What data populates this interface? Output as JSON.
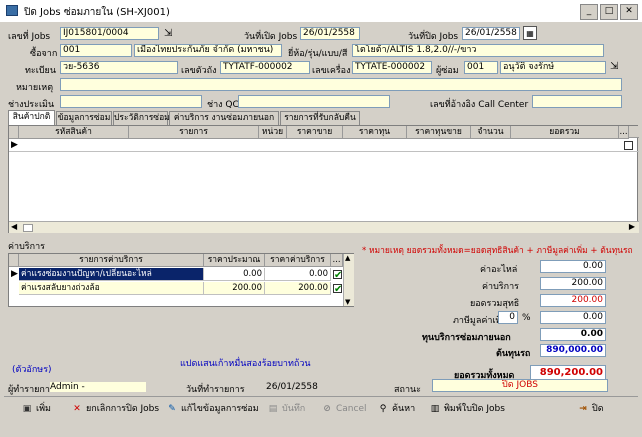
{
  "window": {
    "title": "ปิด Jobs ซ่อมภายใน (SH-XJ001)",
    "min": "_",
    "max": "□",
    "close": "✕"
  },
  "header": {
    "job_no_label": "เลขที่ Jobs",
    "job_no": "IJ015801/0004",
    "open_date_label": "วันที่เปิด Jobs",
    "open_date": "26/01/2558",
    "close_date_label": "วันที่ปิด Jobs",
    "close_date": "26/01/2558",
    "from_label": "ซื้อจาก",
    "from_code": "001",
    "from_name": "เมืองไทยประกันภัย จำกัด (มหาชน)",
    "brand_label": "ยี่ห้อ/รุ่น/แบบ/สี",
    "brand": "โตโยต้า/ALTIS 1.8,2.0//-/ขาว",
    "plate_label": "ทะเบียน",
    "plate": "วย-5636",
    "chassis_label": "เลขตัวถัง",
    "chassis": "TYTATF-000002",
    "engine_label": "เลขเครื่อง",
    "engine": "TYTATE-000002",
    "repairer_label": "ผู้ซ่อม",
    "repairer_code": "001",
    "repairer_name": "อนุวัติ จงรักษ์",
    "note_label": "หมายเหตุ",
    "note": "",
    "assessor_label": "ช่างประเมิน",
    "assessor": "",
    "qc_label": "ช่าง QC",
    "qc": "",
    "callcenter_label": "เลขที่อ้างอิง Call Center",
    "callcenter": ""
  },
  "tabs": [
    "สินค้าปกติ",
    "ข้อมูลการซ่อม",
    "ประวัติการซ่อม",
    "ค่าบริการ งานซ่อมภายนอก",
    "รายการที่รับกลับคืน"
  ],
  "products_table": {
    "columns": [
      "รหัสสินค้า",
      "รายการ",
      "หน่วย",
      "ราคาขาย",
      "ราคาทุน",
      "ราคาทุนขาย",
      "จำนวน",
      "ยอดรวม",
      "..."
    ]
  },
  "services": {
    "title": "ค่าบริการ",
    "columns": [
      "รายการค่าบริการ",
      "ราคาประมาณ",
      "ราคาค่าบริการ",
      "..."
    ],
    "rows": [
      {
        "name": "ค่าแรงซ่อมงานปัญหา/เปลี่ยนอะไหล่",
        "estimate": "0.00",
        "price": "0.00",
        "checked": "✔"
      },
      {
        "name": "ค่าแรงสลับยางถ่วงล้อ",
        "estimate": "200.00",
        "price": "200.00",
        "checked": "✔"
      }
    ]
  },
  "notice": "* หมายเหตุ  ยอดรวมทั้งหมด=ยอดสุทธิสินค้า + ภาษีมูลค่าเพิ่ม + ต้นทุนรถ",
  "totals": {
    "parts_label": "ค่าอะไหล่",
    "parts": "0.00",
    "service_label": "ค่าบริการ",
    "service": "200.00",
    "net_label": "ยอดรวมสุทธิ",
    "net": "200.00",
    "vat_label": "ภาษีมูลค่าเพิ่ม",
    "vat_pct": "0",
    "vat_pct_sign": "%",
    "vat": "0.00",
    "ext_label": "ทุนบริการซ่อมภายนอก",
    "ext": "0.00",
    "cost_label": "ต้นทุนรถ",
    "cost": "890,000.00",
    "grand_label": "ยอดรวมทั้งหมด",
    "grand": "890,200.00"
  },
  "text_amount_label": "(ตัวอักษร)",
  "text_amount": "แปดแสนเก้าหมื่นสองร้อยบาทถ้วน",
  "footer": {
    "recorder_label": "ผู้ทำรายการ",
    "recorder": "Admin -",
    "txn_date_label": "วันที่ทำรายการ",
    "txn_date": "26/01/2558",
    "status_label": "สถานะ",
    "status": "ปิด JOBS"
  },
  "toolbar": {
    "add": "เพิ่ม",
    "cancel_close": "ยกเลิกการปิด Jobs",
    "edit": "แก้ไขข้อมูลการซ่อม",
    "save": "บันทึก",
    "cancel": "Cancel",
    "search": "ค้นหา",
    "print": "พิมพ์ใบปิด Jobs",
    "exit": "ปิด"
  },
  "colors": {
    "bg": "#d4d0c8",
    "field": "#ffffdd",
    "accent": "#0a246a",
    "red": "#d00000",
    "blue": "#0000c0"
  }
}
